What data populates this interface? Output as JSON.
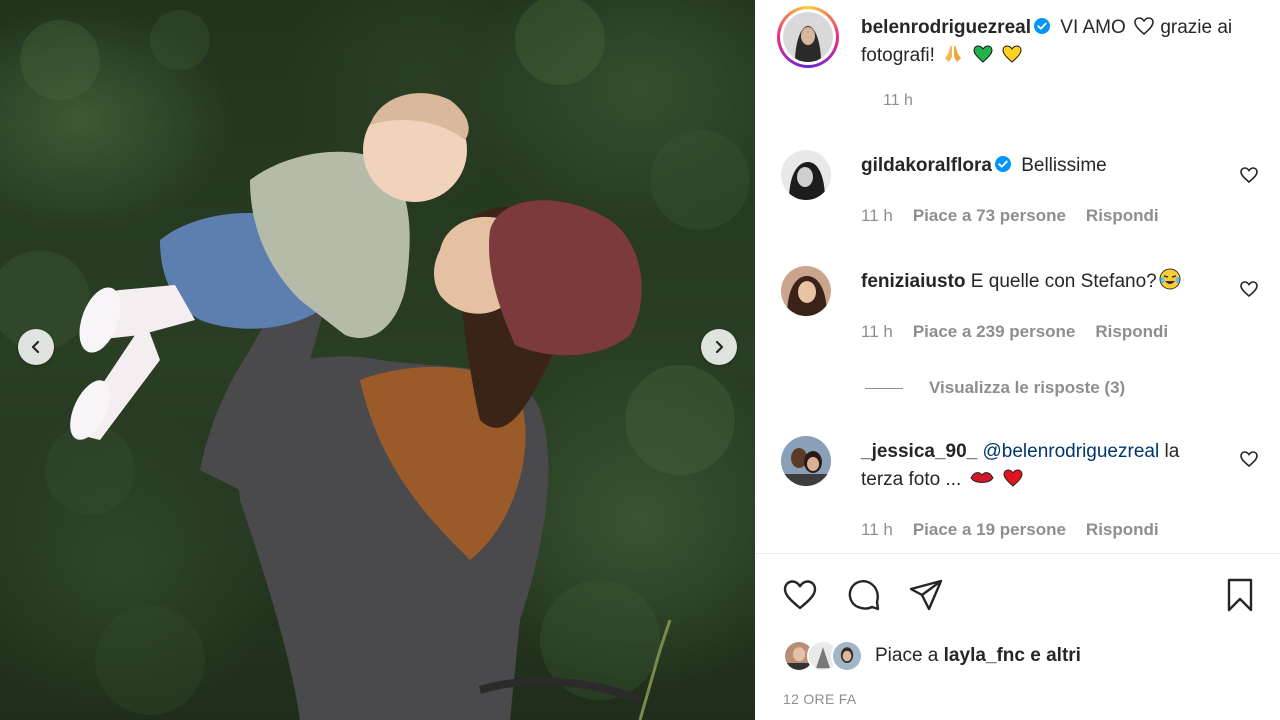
{
  "post": {
    "author": "belenrodriguezreal",
    "caption_text": "VI AMO",
    "caption_text2": "grazie ai fotografi!",
    "time": "11 h",
    "date_label": "12 ORE FA"
  },
  "comments": [
    {
      "username": "gildakoralflora",
      "verified": true,
      "text": "Bellissime",
      "time": "11 h",
      "likes": "Piace a 73 persone",
      "reply": "Rispondi"
    },
    {
      "username": "feniziaiusto",
      "verified": false,
      "text": "E quelle con Stefano?",
      "time": "11 h",
      "likes": "Piace a 239 persone",
      "reply": "Rispondi",
      "view_replies": "Visualizza le risposte (3)"
    },
    {
      "username": "_jessica_90_",
      "verified": false,
      "mention": "@belenrodriguezreal",
      "text": "la terza foto ...",
      "time": "11 h",
      "likes": "Piace a 19 persone",
      "reply": "Rispondi"
    }
  ],
  "likes_summary": {
    "prefix": "Piace a",
    "user": "layla_fnc",
    "suffix": "e altri"
  },
  "icons": {
    "like": "heart-icon",
    "comment": "comment-icon",
    "share": "send-icon",
    "save": "bookmark-icon",
    "verified": "verified-badge-icon",
    "prev": "chevron-left-icon",
    "next": "chevron-right-icon"
  },
  "colors": {
    "verified": "#0095f6",
    "muted": "#8e8e8e",
    "text": "#262626",
    "mention": "#00376b"
  }
}
